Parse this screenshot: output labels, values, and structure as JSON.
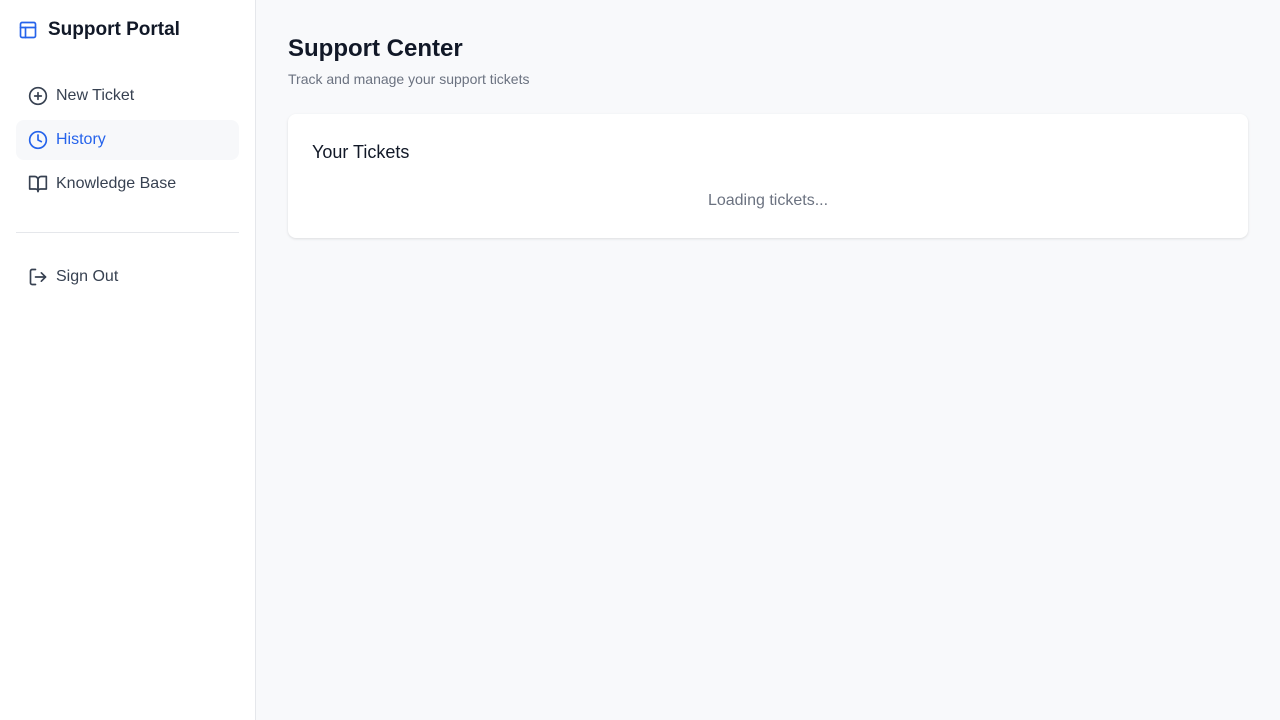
{
  "sidebar": {
    "brand": {
      "title": "Support Portal",
      "icon": "layout-icon"
    },
    "nav": [
      {
        "label": "New Ticket",
        "icon": "plus-circle-icon",
        "active": false
      },
      {
        "label": "History",
        "icon": "clock-icon",
        "active": true
      },
      {
        "label": "Knowledge Base",
        "icon": "book-open-icon",
        "active": false
      }
    ],
    "signout": {
      "label": "Sign Out",
      "icon": "log-out-icon"
    }
  },
  "main": {
    "title": "Support Center",
    "subtitle": "Track and manage your support tickets",
    "card": {
      "title": "Your Tickets",
      "status": "Loading tickets..."
    }
  },
  "colors": {
    "accent": "#2563eb",
    "sidebar_bg": "#ffffff",
    "main_bg": "#f8f9fb",
    "active_bg": "#f7f8fa"
  }
}
